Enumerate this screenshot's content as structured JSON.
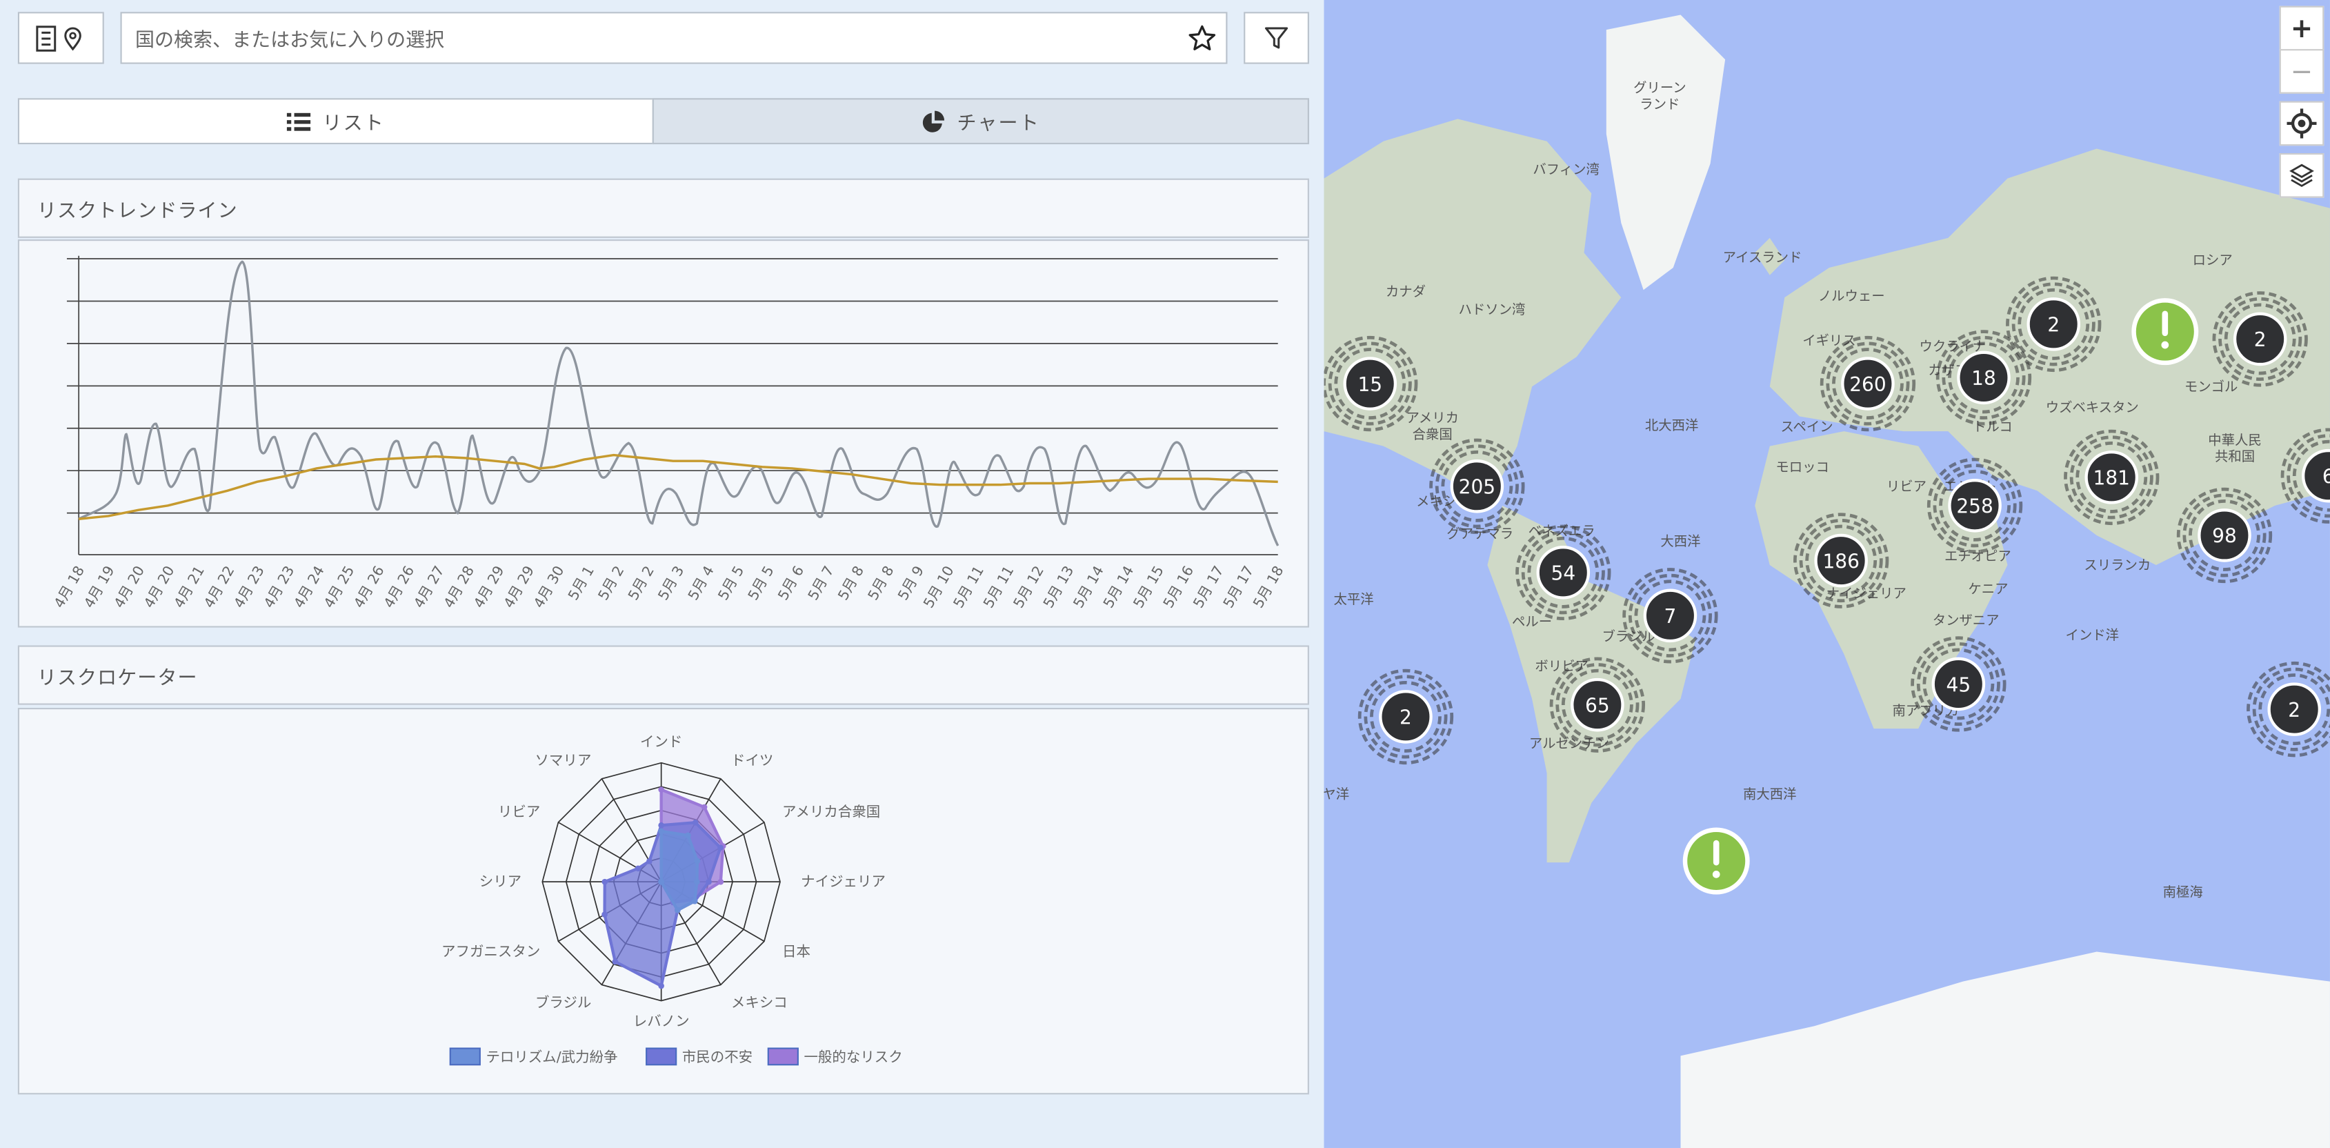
{
  "search": {
    "placeholder": "国の検索、またはお気に入りの選択"
  },
  "tabs": [
    {
      "label": "リスト"
    },
    {
      "label": "チャート"
    }
  ],
  "trend": {
    "title": "リスクトレンドライン",
    "colors": {
      "volatile": "#8e959e",
      "average": "#c69a2e"
    },
    "dates": [
      "4月 18",
      "4月 19",
      "4月 20",
      "4月 20",
      "4月 21",
      "4月 22",
      "4月 23",
      "4月 23",
      "4月 24",
      "4月 25",
      "4月 26",
      "4月 26",
      "4月 27",
      "4月 28",
      "4月 29",
      "4月 29",
      "4月 30",
      "5月 1",
      "5月 2",
      "5月 2",
      "5月 3",
      "5月 4",
      "5月 5",
      "5月 5",
      "5月 6",
      "5月 7",
      "5月 8",
      "5月 8",
      "5月 9",
      "5月 10",
      "5月 11",
      "5月 11",
      "5月 12",
      "5月 13",
      "5月 14",
      "5月 14",
      "5月 15",
      "5月 16",
      "5月 17",
      "5月 17",
      "5月 18"
    ]
  },
  "locator": {
    "title": "リスクロケーター",
    "axes": [
      "インド",
      "ドイツ",
      "アメリカ合衆国",
      "ナイジェリア",
      "日本",
      "メキシコ",
      "レバノン",
      "ブラジル",
      "アフガニスタン",
      "シリア",
      "リビア",
      "ソマリア"
    ],
    "series": [
      {
        "name": "テロリズム/武力紛争",
        "color": "#6a8fd8",
        "values": [
          1.7,
          1.8,
          1.4,
          1.2,
          1.3,
          1.1,
          0,
          0,
          0,
          0,
          0,
          0
        ]
      },
      {
        "name": "市民の不安",
        "color": "#6f75d6",
        "values": [
          1.9,
          2.3,
          2.3,
          1.6,
          1.3,
          1.1,
          3.5,
          3.1,
          2.2,
          1.9,
          0.9,
          0.8
        ]
      },
      {
        "name": "一般的なリスク",
        "color": "#9b79d8",
        "values": [
          3.1,
          2.9,
          2.4,
          2.0,
          1.2,
          0.8,
          0,
          0,
          0,
          0,
          0,
          0
        ]
      }
    ]
  },
  "map": {
    "clusters": [
      "15",
      "205",
      "54",
      "7",
      "65",
      "2",
      "260",
      "18",
      "2",
      "2",
      "181",
      "258",
      "186",
      "98",
      "45",
      "2",
      "6"
    ],
    "labels": [
      "グリーン ランド",
      "バフィン湾",
      "アイスランド",
      "ロシア",
      "カナダ",
      "ハドソン湾",
      "ノルウェー",
      "イギリス",
      "ウクライナ",
      "カザフ",
      "ウズベキスタン",
      "モンゴル",
      "アメリカ 合衆国",
      "北大西洋",
      "スペイン",
      "モロッコ",
      "トルコ",
      "中華人民 共和国",
      "メキシコ",
      "リビア",
      "エジプト",
      "ベネズエラ",
      "大西洋",
      "ナイジェリア",
      "エチオピア",
      "ケニア",
      "スリランカ",
      "インド洋",
      "太平洋",
      "ペルー",
      "ブラジル",
      "ボリビア",
      "タンザニア",
      "アルゼンチン",
      "南アフリカ",
      "南大西洋",
      "南極海",
      "ヤ洋",
      "グアテマラ"
    ],
    "zoom_in": "+",
    "zoom_out": "−"
  }
}
